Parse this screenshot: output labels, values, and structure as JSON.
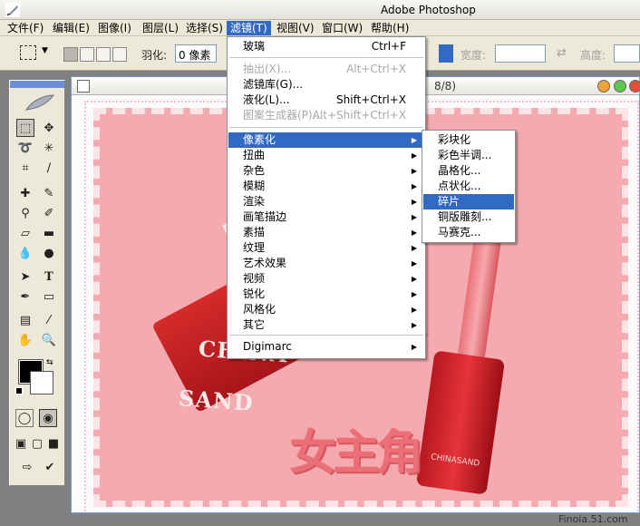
{
  "app": {
    "title": "Adobe Photoshop"
  },
  "menubar": {
    "items": [
      {
        "label": "文件(F)"
      },
      {
        "label": "编辑(E)"
      },
      {
        "label": "图像(I)"
      },
      {
        "label": "图层(L)"
      },
      {
        "label": "选择(S)"
      },
      {
        "label": "滤镜(T)",
        "active": true
      },
      {
        "label": "视图(V)"
      },
      {
        "label": "窗口(W)"
      },
      {
        "label": "帮助(H)"
      }
    ]
  },
  "options": {
    "feather_label": "羽化:",
    "feather_value": "0 像素",
    "width_label": "宽度:",
    "height_label": "高度:"
  },
  "document": {
    "title_fragment": "8/8)",
    "artwork": {
      "brand_line1": "CHINA",
      "brand_line2": "SAND",
      "brand_small": "CHINASAND",
      "heading": "女主角"
    }
  },
  "filter_menu": {
    "items": [
      {
        "label": "玻璃",
        "shortcut": "Ctrl+F"
      },
      {
        "label": "抽出(X)...",
        "shortcut": "Alt+Ctrl+X",
        "disabled": true
      },
      {
        "label": "滤镜库(G)..."
      },
      {
        "label": "液化(L)...",
        "shortcut": "Shift+Ctrl+X"
      },
      {
        "label": "图案生成器(P)...",
        "shortcut": "Alt+Shift+Ctrl+X",
        "disabled": true
      },
      {
        "label": "像素化",
        "submenu": true,
        "highlighted": true
      },
      {
        "label": "扭曲",
        "submenu": true
      },
      {
        "label": "杂色",
        "submenu": true
      },
      {
        "label": "模糊",
        "submenu": true
      },
      {
        "label": "渲染",
        "submenu": true
      },
      {
        "label": "画笔描边",
        "submenu": true
      },
      {
        "label": "素描",
        "submenu": true
      },
      {
        "label": "纹理",
        "submenu": true
      },
      {
        "label": "艺术效果",
        "submenu": true
      },
      {
        "label": "视频",
        "submenu": true
      },
      {
        "label": "锐化",
        "submenu": true
      },
      {
        "label": "风格化",
        "submenu": true
      },
      {
        "label": "其它",
        "submenu": true
      },
      {
        "label": "Digimarc",
        "submenu": true
      }
    ]
  },
  "pixelate_submenu": {
    "items": [
      {
        "label": "彩块化"
      },
      {
        "label": "彩色半调..."
      },
      {
        "label": "晶格化..."
      },
      {
        "label": "点状化..."
      },
      {
        "label": "碎片",
        "highlighted": true
      },
      {
        "label": "铜版雕刻..."
      },
      {
        "label": "马赛克..."
      }
    ]
  },
  "watermark": "Finoia.51.com",
  "colors": {
    "menu_highlight": "#316ac5",
    "canvas_pink": "#f4aaaf",
    "foreground": "#000000",
    "background": "#ffffff"
  }
}
